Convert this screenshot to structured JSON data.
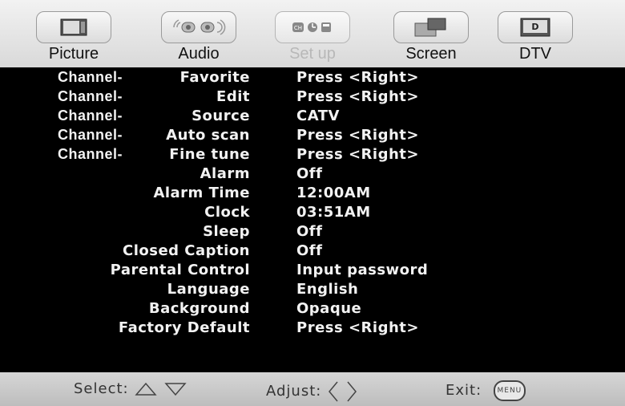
{
  "tabs": [
    {
      "label": "Picture",
      "icon": "tv-picture-icon"
    },
    {
      "label": "Audio",
      "icon": "speaker-icon"
    },
    {
      "label": "Set up",
      "icon": "setup-icon",
      "active": true
    },
    {
      "label": "Screen",
      "icon": "screen-icon"
    },
    {
      "label": "DTV",
      "icon": "dtv-icon"
    }
  ],
  "setup_icon_text": "CH",
  "dtv_icon_text": "D",
  "menu": [
    {
      "prefix": "Channel-",
      "item": "Favorite",
      "value": "Press <Right>"
    },
    {
      "prefix": "Channel-",
      "item": "Edit",
      "value": "Press <Right>"
    },
    {
      "prefix": "Channel-",
      "item": "Source",
      "value": "CATV"
    },
    {
      "prefix": "Channel-",
      "item": "Auto scan",
      "value": "Press <Right>"
    },
    {
      "prefix": "Channel-",
      "item": "Fine tune",
      "value": "Press <Right>"
    },
    {
      "prefix": "",
      "item": "Alarm",
      "value": "Off"
    },
    {
      "prefix": "",
      "item": "Alarm Time",
      "value": "12:00AM"
    },
    {
      "prefix": "",
      "item": "Clock",
      "value": "03:51AM"
    },
    {
      "prefix": "",
      "item": "Sleep",
      "value": "Off"
    },
    {
      "prefix": "",
      "item": "Closed Caption",
      "value": "Off"
    },
    {
      "prefix": "",
      "item": "Parental Control",
      "value": "Input password"
    },
    {
      "prefix": "",
      "item": "Language",
      "value": "English"
    },
    {
      "prefix": "",
      "item": "Background",
      "value": "Opaque"
    },
    {
      "prefix": "",
      "item": "Factory Default",
      "value": "Press <Right>"
    }
  ],
  "footer": {
    "select_label": "Select:",
    "adjust_label": "Adjust:",
    "exit_label": "Exit:",
    "menu_button_text": "MENU"
  }
}
